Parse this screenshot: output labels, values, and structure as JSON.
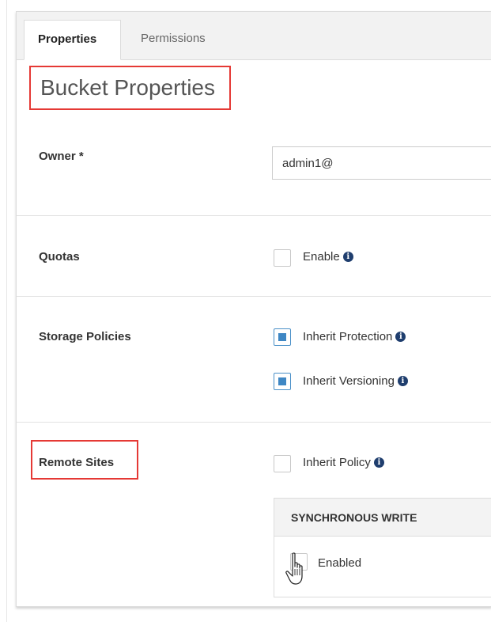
{
  "tabs": [
    {
      "label": "Properties",
      "active": true
    },
    {
      "label": "Permissions",
      "active": false
    }
  ],
  "page_title": "Bucket Properties",
  "owner": {
    "label": "Owner *",
    "value": "admin1@"
  },
  "quotas": {
    "label": "Quotas",
    "enable_label": "Enable",
    "enable_checked": false
  },
  "storage_policies": {
    "label": "Storage Policies",
    "inherit_protection": {
      "label": "Inherit Protection",
      "checked": true
    },
    "inherit_versioning": {
      "label": "Inherit Versioning",
      "checked": true
    }
  },
  "remote_sites": {
    "label": "Remote Sites",
    "inherit_policy": {
      "label": "Inherit Policy",
      "checked": false
    },
    "synchronous_write": {
      "title": "SYNCHRONOUS WRITE",
      "enabled_label": "Enabled",
      "enabled_checked": false
    }
  },
  "icons": {
    "info": "info-icon",
    "cursor": "hand-pointer-icon"
  },
  "colors": {
    "highlight": "#e53935",
    "checkbox_accent": "#3f87c4",
    "info_icon": "#1f3e6e"
  }
}
